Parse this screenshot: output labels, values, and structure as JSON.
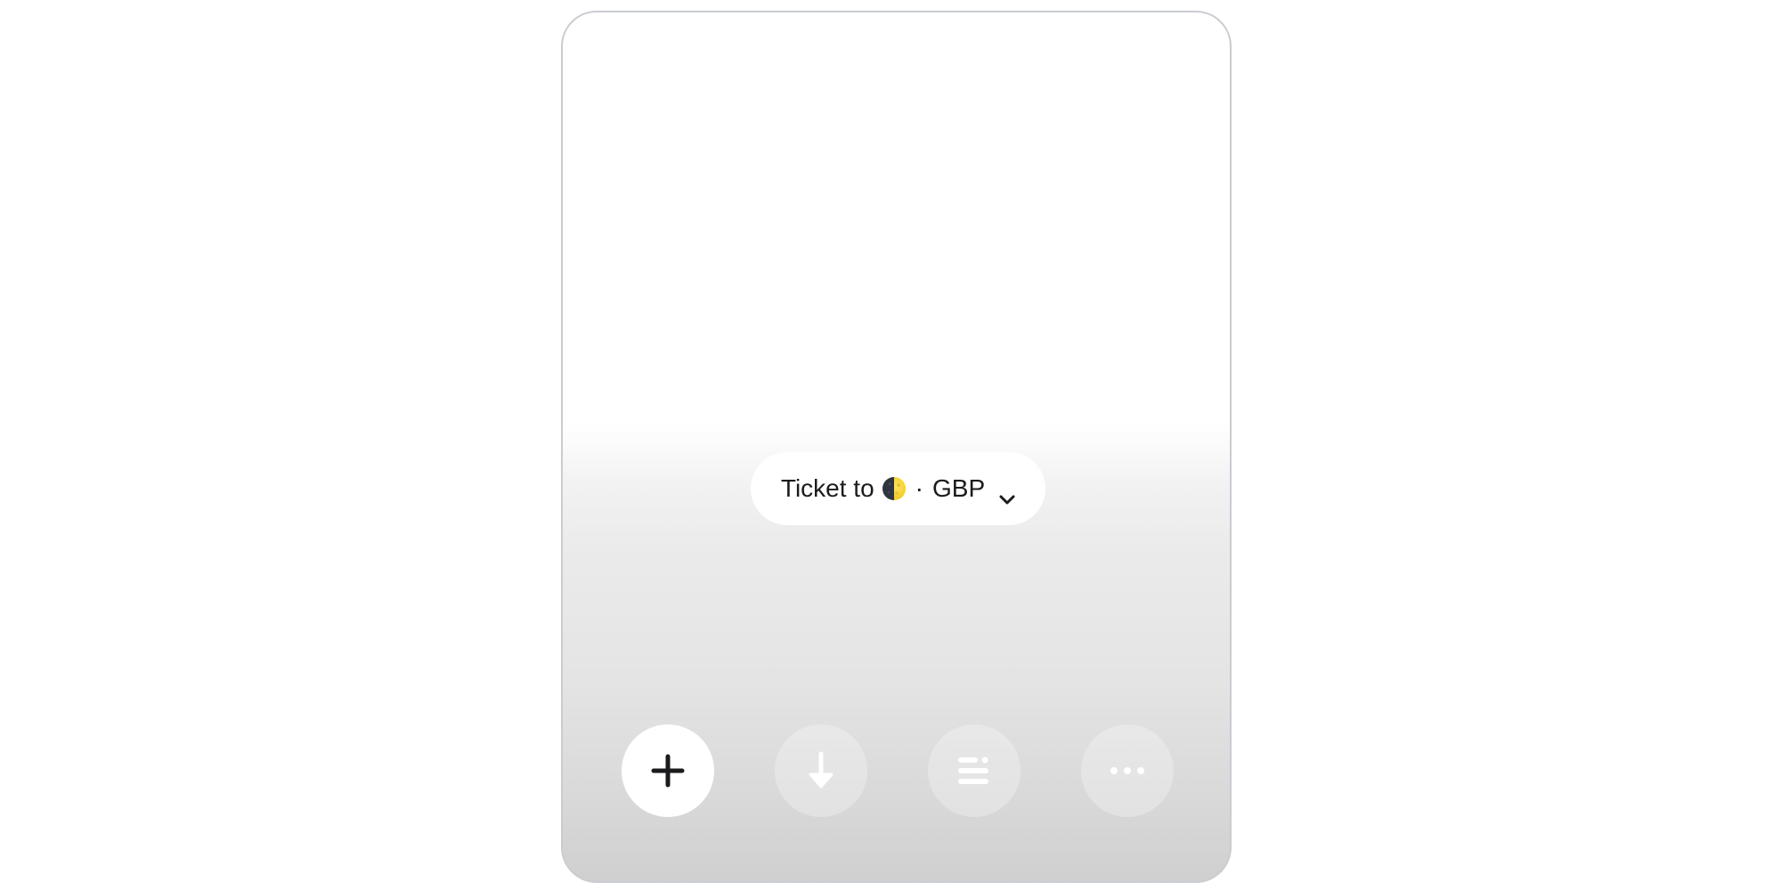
{
  "selector": {
    "label": "Ticket to",
    "emoji_icon": "first-quarter-moon-icon",
    "separator": "·",
    "currency": "GBP",
    "dropdown_icon": "chevron-down-icon"
  },
  "actions": [
    {
      "icon": "plus-icon",
      "color": "#1b1b1d"
    },
    {
      "icon": "arrow-down-icon",
      "color": "#ffffff"
    },
    {
      "icon": "list-icon",
      "color": "#ffffff"
    },
    {
      "icon": "more-dots-icon",
      "color": "#ffffff"
    }
  ],
  "colors": {
    "text": "#1b1b1d",
    "moon_light": "#f7d83a",
    "moon_dark": "#2f3440"
  }
}
